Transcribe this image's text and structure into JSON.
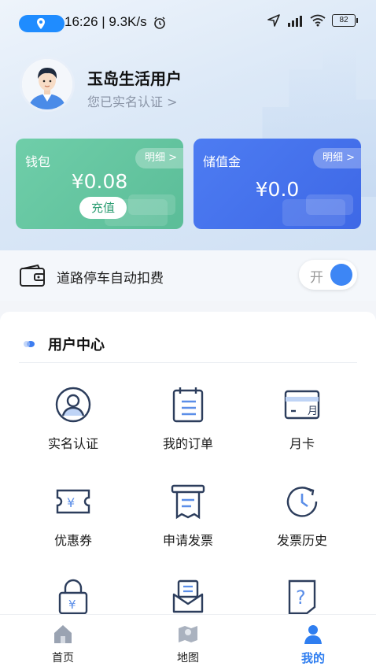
{
  "status_bar": {
    "time_speed": "16:26 | 9.3K/s",
    "battery": "82"
  },
  "profile": {
    "username": "玉岛生活用户",
    "verified_text": "您已实名认证 >"
  },
  "wallet_card": {
    "title": "钱包",
    "detail_label": "明细 >",
    "amount": "¥0.08",
    "recharge_label": "充值",
    "color": "#63c6a0"
  },
  "stored_card": {
    "title": "储值金",
    "detail_label": "明细 >",
    "amount": "¥0.0",
    "color": "#4473ec"
  },
  "auto_deduct": {
    "label": "道路停车自动扣费",
    "toggle_text": "开",
    "enabled": true
  },
  "user_center": {
    "title": "用户中心",
    "items": [
      {
        "label": "实名认证",
        "icon": "id-verify-icon"
      },
      {
        "label": "我的订单",
        "icon": "order-icon"
      },
      {
        "label": "月卡",
        "icon": "month-card-icon"
      },
      {
        "label": "优惠券",
        "icon": "coupon-icon"
      },
      {
        "label": "申请发票",
        "icon": "invoice-apply-icon"
      },
      {
        "label": "发票历史",
        "icon": "invoice-history-icon"
      },
      {
        "label": "",
        "icon": "lock-yuan-icon"
      },
      {
        "label": "",
        "icon": "mail-icon"
      },
      {
        "label": "",
        "icon": "help-icon"
      }
    ]
  },
  "bottom_nav": {
    "items": [
      {
        "label": "首页",
        "icon": "home-icon"
      },
      {
        "label": "地图",
        "icon": "map-icon"
      },
      {
        "label": "我的",
        "icon": "user-icon"
      }
    ],
    "active_color": "#2f7ef0"
  }
}
